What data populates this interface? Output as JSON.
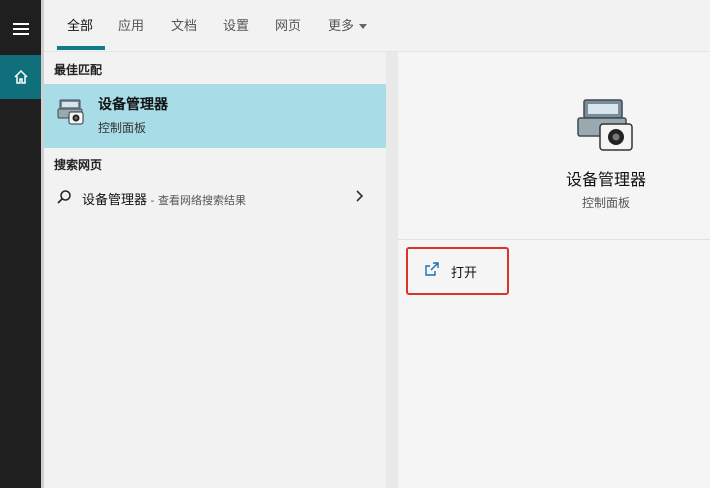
{
  "tabs": [
    {
      "label": "全部"
    },
    {
      "label": "应用"
    },
    {
      "label": "文档"
    },
    {
      "label": "设置"
    },
    {
      "label": "网页"
    },
    {
      "label": "更多"
    }
  ],
  "results": {
    "best_match_header": "最佳匹配",
    "best_match": {
      "title": "设备管理器",
      "subtitle": "控制面板",
      "icon": "device-manager-icon"
    },
    "web_header": "搜索网页",
    "web_item": {
      "query": "设备管理器",
      "hint": " - 查看网络搜索结果",
      "icon": "search-icon"
    }
  },
  "preview": {
    "title": "设备管理器",
    "subtitle": "控制面板",
    "open_label": "打开"
  },
  "colors": {
    "accent": "#0f7a8a",
    "selection": "#a8dde8",
    "highlight_box": "#d9332c",
    "rail": "#1f1f1f"
  }
}
